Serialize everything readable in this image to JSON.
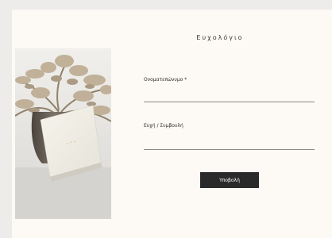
{
  "form": {
    "title": "Ευχολόγιο",
    "fields": [
      {
        "label": "Ονοματεπώνυμο *",
        "value": ""
      },
      {
        "label": "Ευχή / Συμβουλή",
        "value": ""
      }
    ],
    "submit_label": "Υποβολή"
  },
  "photo": {
    "description_icon": "guestbook-photo",
    "book_emblem": "guestbook cover mark"
  },
  "colors": {
    "background": "#eeecea",
    "card": "#fdf9f4",
    "button": "#2a2a2a",
    "underline": "#8a8784",
    "book": "#f1efe7",
    "book_text": "#c9b27a"
  }
}
